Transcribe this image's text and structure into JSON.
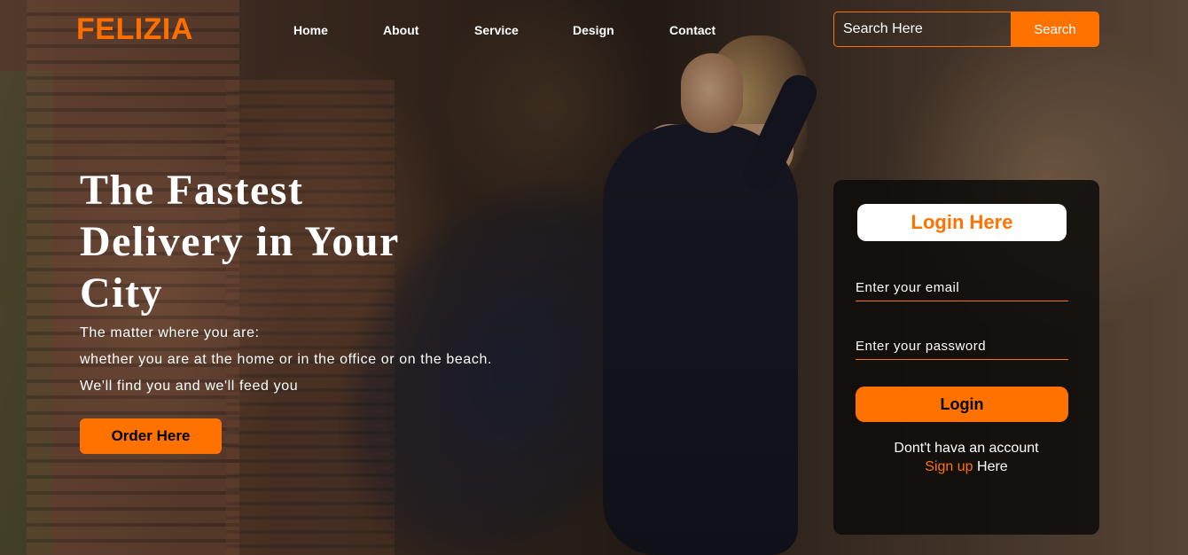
{
  "brand": {
    "logo": "FELIZIA",
    "accent_color": "#ff7200"
  },
  "nav": {
    "items": [
      {
        "label": "Home"
      },
      {
        "label": "About"
      },
      {
        "label": "Service"
      },
      {
        "label": "Design"
      },
      {
        "label": "Contact"
      }
    ]
  },
  "search": {
    "placeholder": "Search Here",
    "button_label": "Search"
  },
  "hero": {
    "title": "The Fastest Delivery in Your City",
    "lines": [
      "The matter where you are:",
      "whether you are at the home or in the office or on the beach.",
      "We'll find you and we'll feed you"
    ],
    "cta_label": "Order Here"
  },
  "login": {
    "title": "Login Here",
    "email_placeholder": "Enter your email",
    "password_placeholder": "Enter your password",
    "button_label": "Login",
    "signup_prefix": "Dont't hava an account",
    "signup_link": "Sign up",
    "signup_suffix": " Here"
  }
}
